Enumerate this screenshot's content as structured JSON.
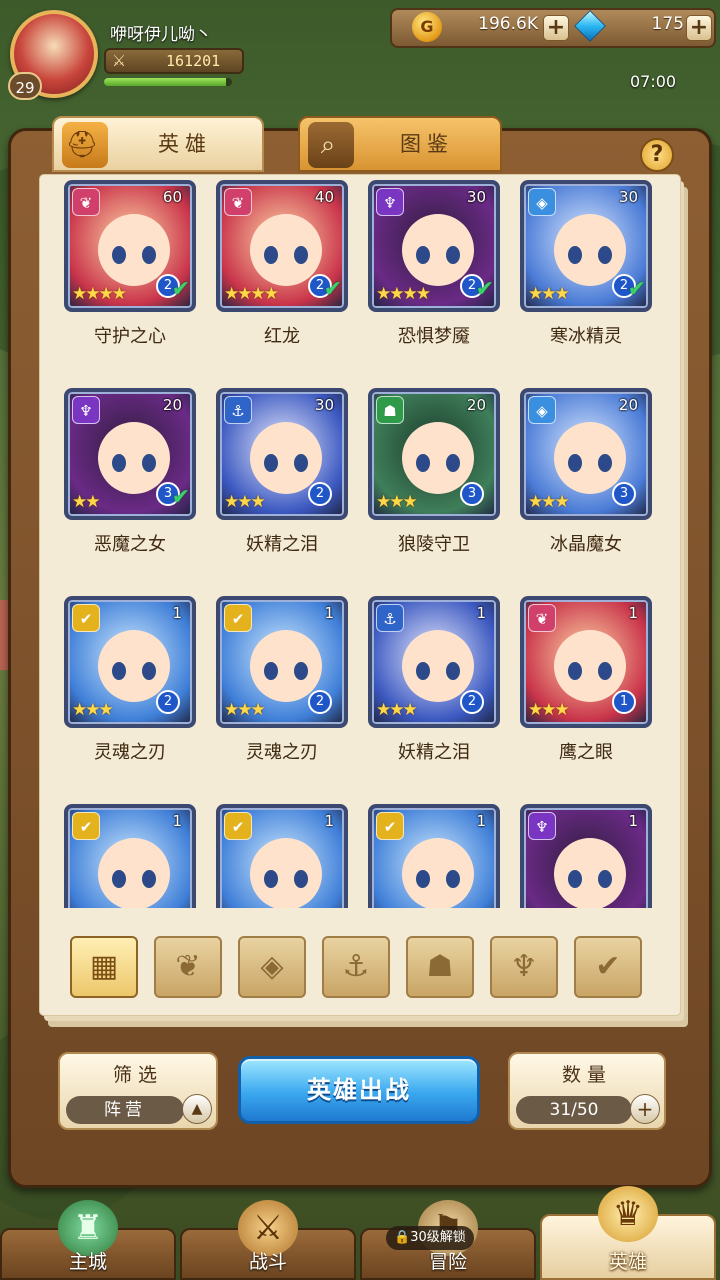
{
  "player": {
    "name": "咿呀伊儿呦丶",
    "level": "29",
    "power": "161201",
    "xp_fraction": 0.95
  },
  "resources": {
    "gold": "196.6K",
    "gems": "175",
    "plus_symbol": "+"
  },
  "clock": "07:00",
  "tabs": [
    {
      "label": "英雄",
      "icon": "knight-helmet-icon"
    },
    {
      "label": "图鉴",
      "icon": "magnifier-icon"
    }
  ],
  "help_label": "?",
  "heroes": [
    {
      "name": "守护之心",
      "level": "60",
      "faction": "fire",
      "stars": "★★★★",
      "tier": "2",
      "checked": true
    },
    {
      "name": "红龙",
      "level": "40",
      "faction": "fire",
      "stars": "★★★★",
      "tier": "2",
      "checked": true
    },
    {
      "name": "恐惧梦魇",
      "level": "30",
      "faction": "demon",
      "stars": "★★★★",
      "tier": "2",
      "checked": true
    },
    {
      "name": "寒冰精灵",
      "level": "30",
      "faction": "ice",
      "stars": "★★★",
      "tier": "2",
      "checked": true
    },
    {
      "name": "恶魔之女",
      "level": "20",
      "faction": "demon",
      "stars": "★★",
      "tier": "3",
      "checked": true
    },
    {
      "name": "妖精之泪",
      "level": "30",
      "faction": "ocean",
      "stars": "★★★",
      "tier": "2",
      "checked": false
    },
    {
      "name": "狼陵守卫",
      "level": "20",
      "faction": "beast",
      "stars": "★★★",
      "tier": "3",
      "checked": false
    },
    {
      "name": "冰晶魔女",
      "level": "20",
      "faction": "ice",
      "stars": "★★★",
      "tier": "3",
      "checked": false
    },
    {
      "name": "灵魂之刃",
      "level": "1",
      "faction": "light",
      "stars": "★★★",
      "tier": "2",
      "checked": false
    },
    {
      "name": "灵魂之刃",
      "level": "1",
      "faction": "light",
      "stars": "★★★",
      "tier": "2",
      "checked": false
    },
    {
      "name": "妖精之泪",
      "level": "1",
      "faction": "ocean",
      "stars": "★★★",
      "tier": "2",
      "checked": false
    },
    {
      "name": "鹰之眼",
      "level": "1",
      "faction": "fire",
      "stars": "★★★",
      "tier": "1",
      "checked": false
    },
    {
      "name": "",
      "level": "1",
      "faction": "light",
      "stars": "",
      "tier": "",
      "checked": false
    },
    {
      "name": "",
      "level": "1",
      "faction": "light",
      "stars": "",
      "tier": "",
      "checked": false
    },
    {
      "name": "",
      "level": "1",
      "faction": "light",
      "stars": "",
      "tier": "",
      "checked": false
    },
    {
      "name": "",
      "level": "1",
      "faction": "demon",
      "stars": "",
      "tier": "",
      "checked": false
    }
  ],
  "faction_filters": [
    "all-grid-icon",
    "fire-faction-icon",
    "ice-faction-icon",
    "ocean-anchor-icon",
    "beast-faction-icon",
    "demon-faction-icon",
    "light-faction-icon"
  ],
  "filter": {
    "title": "筛选",
    "value": "阵营"
  },
  "deploy_label": "英雄出战",
  "count": {
    "title": "数量",
    "value": "31/50"
  },
  "nav": [
    {
      "label": "主城",
      "icon": "castle-icon"
    },
    {
      "label": "战斗",
      "icon": "crossed-swords-icon"
    },
    {
      "label": "冒险",
      "icon": "adventure-icon",
      "lock": "30级解锁"
    },
    {
      "label": "英雄",
      "icon": "hero-crest-icon",
      "active": true
    }
  ],
  "colors": {
    "fire": "#d0406a",
    "demon": "#7a35c2",
    "ice": "#3a8fe0",
    "ocean": "#2f64c9",
    "beast": "#2e9a4a",
    "light": "#e3b21c"
  }
}
